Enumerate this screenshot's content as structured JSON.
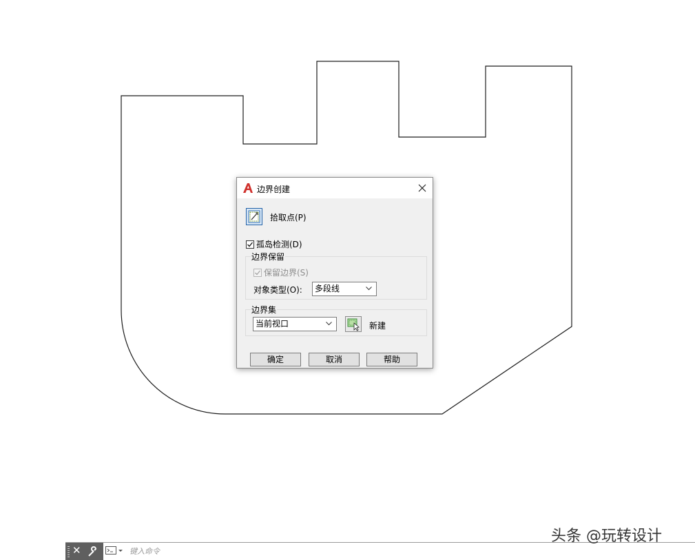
{
  "dialog": {
    "title": "边界创建",
    "pick_points_label": "拾取点(P)",
    "island_detection": {
      "label": "孤岛检测(D)",
      "checked": true
    },
    "boundary_retention": {
      "group_label": "边界保留",
      "retain_boundaries": {
        "label": "保留边界(S)",
        "checked": true,
        "enabled": false
      },
      "object_type_label": "对象类型(O):",
      "object_type_value": "多段线"
    },
    "boundary_set": {
      "group_label": "边界集",
      "selected": "当前视口",
      "new_label": "新建"
    },
    "buttons": {
      "ok": "确定",
      "cancel": "取消",
      "help": "帮助"
    }
  },
  "command_line": {
    "placeholder": "键入命令"
  },
  "watermark": "头条 @玩转设计",
  "colors": {
    "autocad_red": "#d0312d",
    "dialog_bg": "#f0f0f0",
    "command_bar_bg": "#5f5f5f"
  },
  "icons": [
    "autocad-logo-icon",
    "close-icon",
    "pick-points-icon",
    "chevron-down-icon",
    "new-boundary-set-icon",
    "grip-icon",
    "wrench-icon",
    "command-prompt-icon"
  ]
}
